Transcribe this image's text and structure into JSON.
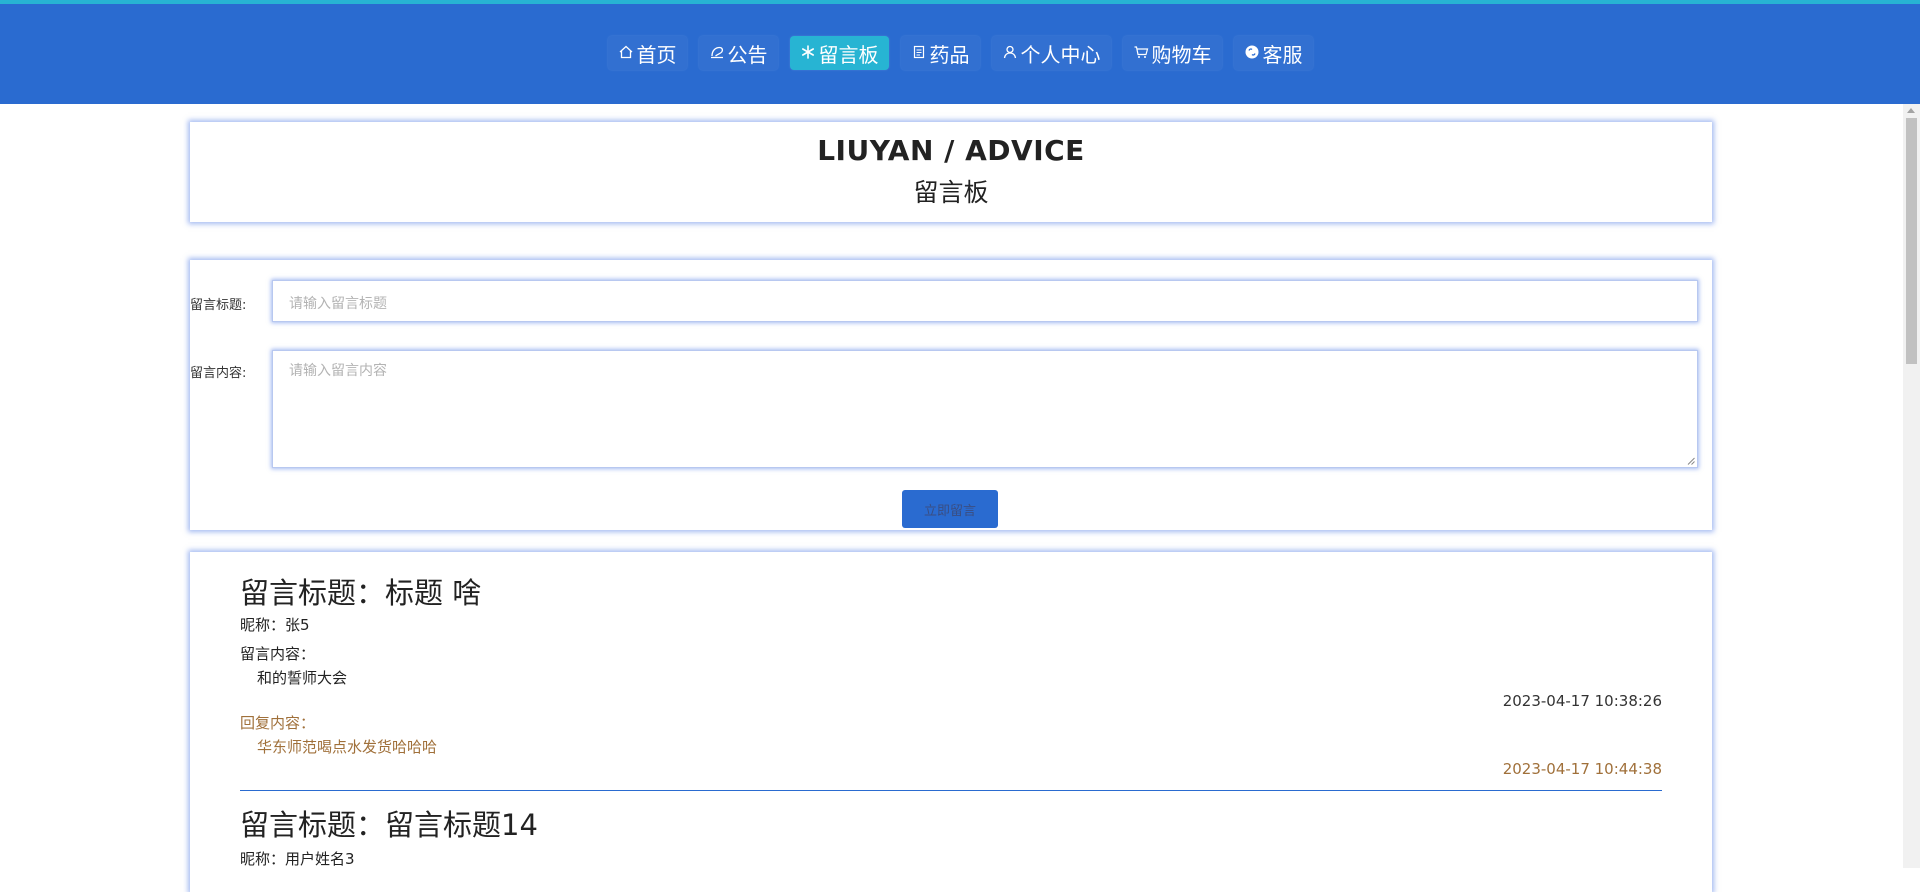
{
  "nav": {
    "items": [
      {
        "label": "首页",
        "icon": "home-icon"
      },
      {
        "label": "公告",
        "icon": "notice-icon"
      },
      {
        "label": "留言板",
        "icon": "snowflake-icon"
      },
      {
        "label": "药品",
        "icon": "document-icon"
      },
      {
        "label": "个人中心",
        "icon": "user-icon"
      },
      {
        "label": "购物车",
        "icon": "cart-icon"
      },
      {
        "label": "客服",
        "icon": "chat-icon"
      }
    ],
    "active": "留言板"
  },
  "header": {
    "en_title": "LIUYAN / ADVICE",
    "cn_title": "留言板"
  },
  "form": {
    "title_label": "留言标题:",
    "title_placeholder": "请输入留言标题",
    "title_value": "",
    "content_label": "留言内容:",
    "content_placeholder": "请输入留言内容",
    "content_value": "",
    "submit_label": "立即留言"
  },
  "messages": [
    {
      "title": "留言标题：标题 啥",
      "nickname": "昵称：张5",
      "content_label": "留言内容：",
      "content": "和的誓师大会",
      "time": "2023-04-17 10:38:26",
      "reply_label": "回复内容：",
      "reply": "华东师范喝点水发货哈哈哈",
      "reply_time": "2023-04-17 10:44:38"
    },
    {
      "title": "留言标题：留言标题14",
      "nickname": "昵称：用户姓名3"
    }
  ],
  "colors": {
    "navbar": "#2a6bd0",
    "active_nav": "#27b4d3",
    "reply_text": "#a0703a"
  }
}
